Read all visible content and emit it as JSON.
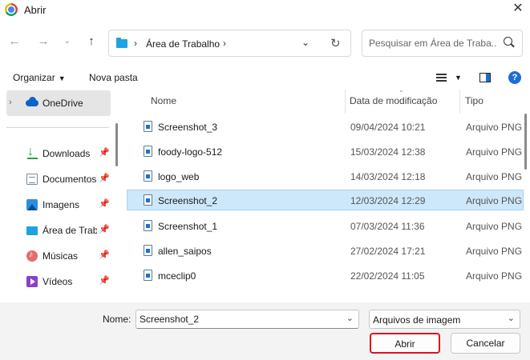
{
  "window": {
    "title": "Abrir"
  },
  "nav": {
    "path": "Área de Trabalho",
    "search_placeholder": "Pesquisar em Área de Traba..."
  },
  "commands": {
    "organize": "Organizar",
    "new_folder": "Nova pasta"
  },
  "sidebar": {
    "onedrive": "OneDrive",
    "items": [
      {
        "label": "Downloads",
        "icon": "download-icon"
      },
      {
        "label": "Documentos",
        "icon": "documents-icon"
      },
      {
        "label": "Imagens",
        "icon": "images-icon"
      },
      {
        "label": "Área de Trabalho",
        "icon": "desktop-icon"
      },
      {
        "label": "Músicas",
        "icon": "music-icon"
      },
      {
        "label": "Vídeos",
        "icon": "videos-icon"
      }
    ]
  },
  "files": {
    "columns": {
      "name": "Nome",
      "date": "Data de modificação",
      "type": "Tipo"
    },
    "rows": [
      {
        "name": "Screenshot_3",
        "date": "09/04/2024 10:21",
        "type": "Arquivo PNG",
        "selected": false
      },
      {
        "name": "foody-logo-512",
        "date": "15/03/2024 12:38",
        "type": "Arquivo PNG",
        "selected": false
      },
      {
        "name": "logo_web",
        "date": "14/03/2024 12:18",
        "type": "Arquivo PNG",
        "selected": false
      },
      {
        "name": "Screenshot_2",
        "date": "12/03/2024 12:29",
        "type": "Arquivo PNG",
        "selected": true
      },
      {
        "name": "Screenshot_1",
        "date": "07/03/2024 11:36",
        "type": "Arquivo PNG",
        "selected": false
      },
      {
        "name": "allen_saipos",
        "date": "27/02/2024 17:21",
        "type": "Arquivo PNG",
        "selected": false
      },
      {
        "name": "mceclip0",
        "date": "22/02/2024 11:05",
        "type": "Arquivo PNG",
        "selected": false
      }
    ]
  },
  "bottom": {
    "name_label": "Nome:",
    "name_value": "Screenshot_2",
    "filter": "Arquivos de imagem",
    "open": "Abrir",
    "cancel": "Cancelar"
  },
  "colors": {
    "selection": "#cde8fb",
    "open_outline": "#e0121b",
    "accent": "#1b6fd2"
  }
}
